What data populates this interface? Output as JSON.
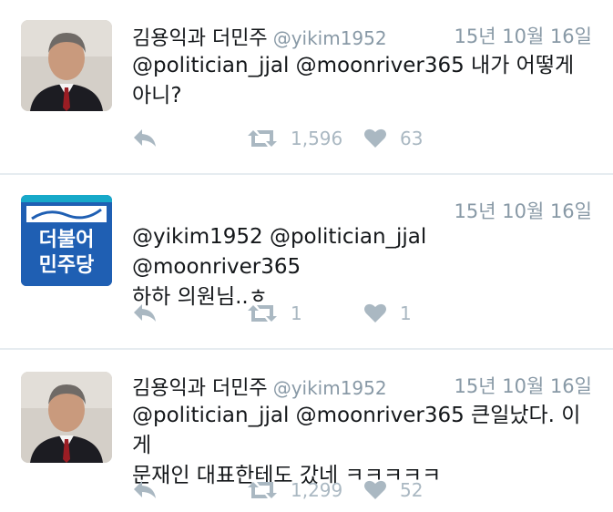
{
  "tweets": [
    {
      "name": "김용익과 더민주",
      "handle": "@yikim1952",
      "date": "15년 10월 16일",
      "text": "@politician_jjal @moonriver365 내가 어떻게\n아니?",
      "retweets": "1,596",
      "likes": "63",
      "avatar": "person-photo"
    },
    {
      "name": "",
      "handle": "",
      "date": "15년 10월 16일",
      "text": "@yikim1952 @politician_jjal @moonriver365\n하하 의원님..ㅎ",
      "retweets": "1",
      "likes": "1",
      "avatar": "party-logo",
      "logo_text_top": "더불어",
      "logo_text_bottom": "민주당"
    },
    {
      "name": "김용익과 더민주",
      "handle": "@yikim1952",
      "date": "15년 10월 16일",
      "text": "@politician_jjal @moonriver365 큰일났다. 이게\n문재인 대표한테도 갔네 ㅋㅋㅋㅋㅋ",
      "retweets": "1,299",
      "likes": "52",
      "avatar": "person-photo"
    }
  ],
  "icons": {
    "reply": "reply-icon",
    "retweet": "retweet-icon",
    "like": "heart-icon"
  },
  "colors": {
    "icon_gray": "#aab8c2",
    "text": "#14171a",
    "meta": "#8899a6",
    "party_blue": "#1f5fb3"
  }
}
